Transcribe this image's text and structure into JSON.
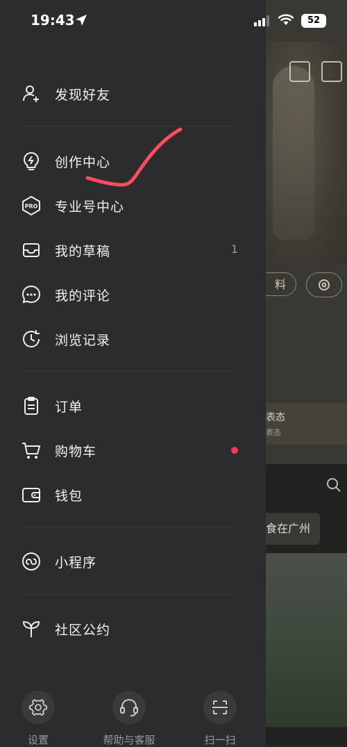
{
  "status": {
    "time": "19:43",
    "battery": "52"
  },
  "drawer": {
    "items": [
      {
        "label": "发现好友",
        "icon": "add-friend-icon"
      },
      {
        "label": "创作中心",
        "icon": "lightbulb-icon"
      },
      {
        "label": "专业号中心",
        "icon": "pro-badge-icon",
        "icon_text": "PRO"
      },
      {
        "label": "我的草稿",
        "icon": "drafts-box-icon",
        "count": "1"
      },
      {
        "label": "我的评论",
        "icon": "comment-icon"
      },
      {
        "label": "浏览记录",
        "icon": "history-clock-icon"
      },
      {
        "label": "订单",
        "icon": "order-clipboard-icon"
      },
      {
        "label": "购物车",
        "icon": "cart-icon",
        "dot": true
      },
      {
        "label": "钱包",
        "icon": "wallet-icon"
      },
      {
        "label": "小程序",
        "icon": "mini-program-icon"
      },
      {
        "label": "社区公约",
        "icon": "sprout-icon"
      }
    ],
    "bottom": [
      {
        "label": "设置",
        "icon": "gear-icon"
      },
      {
        "label": "帮助与客服",
        "icon": "headset-icon"
      },
      {
        "label": "扫一扫",
        "icon": "scan-icon"
      }
    ],
    "annotation": "red-checkmark-scribble"
  },
  "background_app": {
    "edit_button_fragment": "料",
    "card_title_fragment": "表态",
    "card_sub_fragment": "表态",
    "tag_fragment": "食在广州"
  },
  "colors": {
    "drawer_bg": "#2c2c2e",
    "accent_dot": "#ff3355",
    "scribble": "#ff4d5e"
  }
}
